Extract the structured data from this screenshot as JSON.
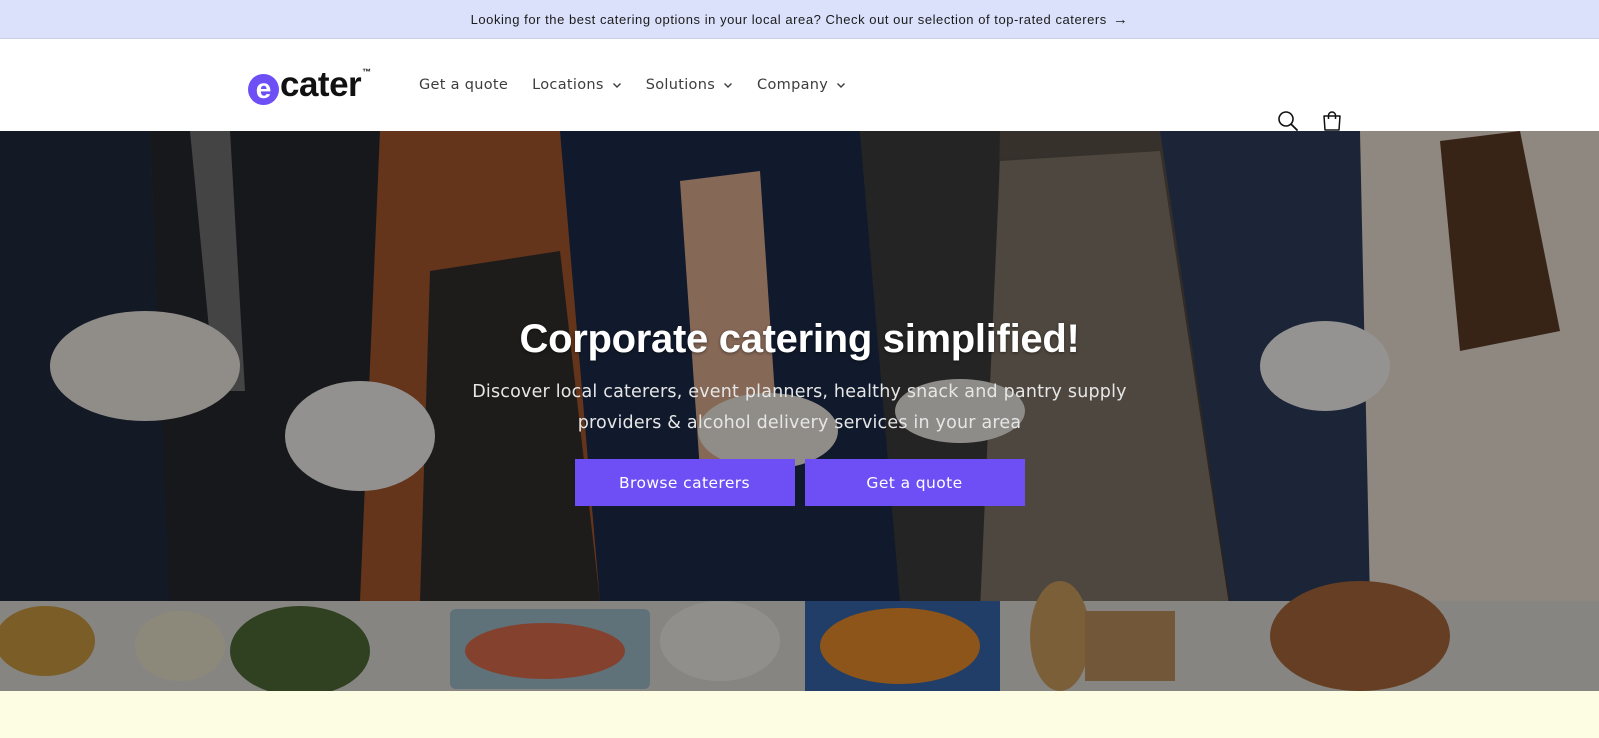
{
  "announcement": {
    "text": "Looking for the best catering options in your local area? Check out our selection of top-rated caterers",
    "arrow": "→"
  },
  "header": {
    "logo": {
      "letter": "e",
      "word": "cater",
      "tm": "™"
    },
    "nav": [
      {
        "label": "Get a quote",
        "has_dropdown": false
      },
      {
        "label": "Locations",
        "has_dropdown": true
      },
      {
        "label": "Solutions",
        "has_dropdown": true
      },
      {
        "label": "Company",
        "has_dropdown": true
      }
    ],
    "icons": [
      "search-icon",
      "cart-icon"
    ]
  },
  "hero": {
    "title": "Corporate catering simplified!",
    "subtitle_line1": "Discover local caterers, event planners, healthy snack and pantry supply",
    "subtitle_line2": "providers & alcohol delivery services in your area",
    "primary_button": "Browse caterers",
    "secondary_button": "Get a quote"
  },
  "colors": {
    "accent": "#6e4ff6",
    "announcement_bg": "#dbe1fb",
    "bottom_bg": "#fdfde4"
  }
}
